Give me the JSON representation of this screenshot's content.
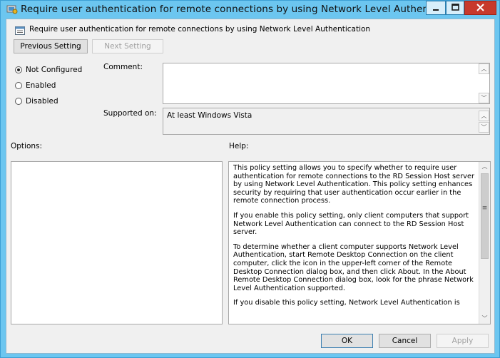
{
  "window": {
    "title": "Require user authentication for remote connections by using Network Level Authent...",
    "controls": [
      "minimize-icon",
      "maximize-icon",
      "close-icon"
    ]
  },
  "policy": {
    "name": "Require user authentication for remote connections by using Network Level Authentication"
  },
  "nav": {
    "previous": "Previous Setting",
    "next": "Next Setting"
  },
  "state": {
    "options": [
      {
        "label": "Not Configured",
        "selected": true
      },
      {
        "label": "Enabled",
        "selected": false
      },
      {
        "label": "Disabled",
        "selected": false
      }
    ]
  },
  "comment": {
    "label": "Comment:",
    "value": ""
  },
  "supported": {
    "label": "Supported on:",
    "value": "At least Windows Vista"
  },
  "options_panel": {
    "label": "Options:"
  },
  "help": {
    "label": "Help:",
    "paragraphs": [
      "This policy setting allows you to specify whether to require user authentication for remote connections to the RD Session Host server by using Network Level Authentication. This policy setting enhances security by requiring that user authentication occur earlier in the remote connection process.",
      "If you enable this policy setting, only client computers that support Network Level Authentication can connect to the RD Session Host server.",
      "To determine whether a client computer supports Network Level Authentication, start Remote Desktop Connection on the client computer, click the icon in the upper-left corner of the Remote Desktop Connection dialog box, and then click About. In the About Remote Desktop Connection dialog box, look for the phrase Network Level Authentication supported.",
      "If you disable this policy setting, Network Level Authentication is"
    ]
  },
  "footer": {
    "ok": "OK",
    "cancel": "Cancel",
    "apply": "Apply"
  }
}
